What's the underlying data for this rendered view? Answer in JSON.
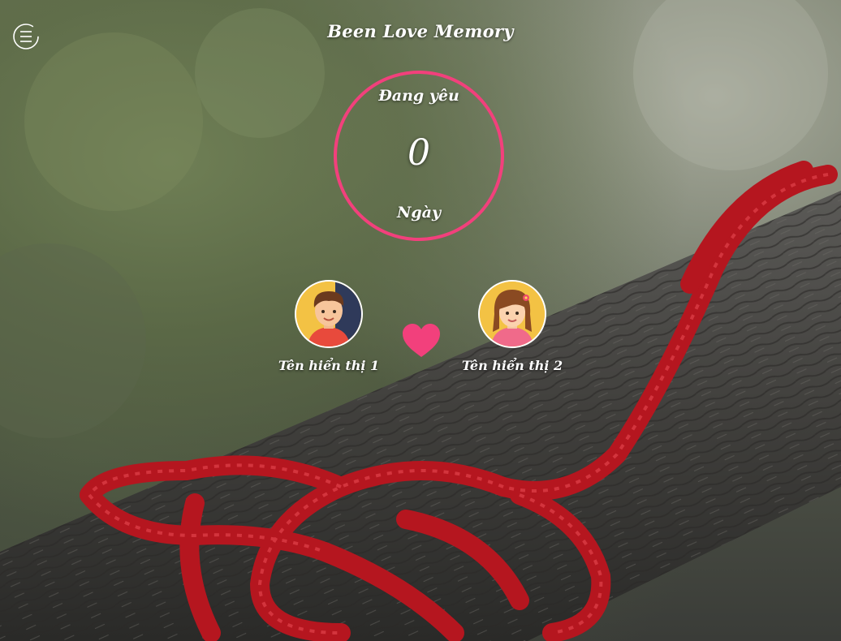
{
  "header": {
    "title": "Been Love Memory",
    "menu_icon": "hamburger-circle-icon"
  },
  "counter": {
    "top_label": "Đang yêu",
    "value": "0",
    "unit_label": "Ngày",
    "ring_color": "#f2407c"
  },
  "couple": {
    "person1": {
      "name": "Tên hiển thị 1",
      "avatar": "boy-avatar"
    },
    "person2": {
      "name": "Tên hiển thị 2",
      "avatar": "girl-avatar"
    },
    "heart_icon": "heart-icon",
    "heart_color": "#f2407c"
  },
  "background": {
    "description_icon": "red-rope-heart-knot-on-branch-photo"
  }
}
